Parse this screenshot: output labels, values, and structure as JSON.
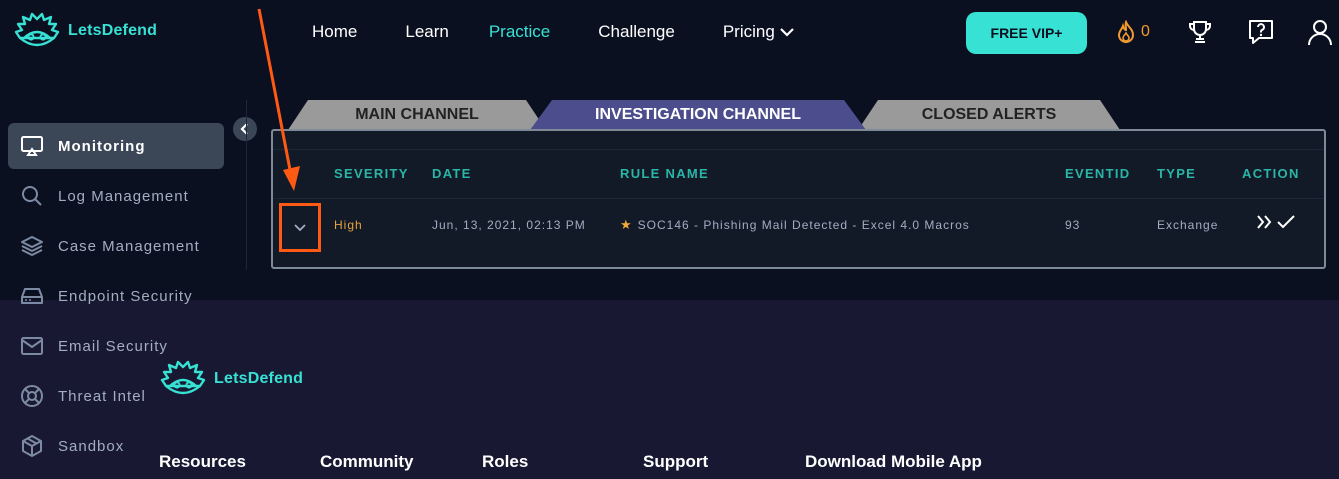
{
  "brand": {
    "name": "LetsDefend"
  },
  "nav": {
    "items": [
      "Home",
      "Learn",
      "Practice",
      "Challenge",
      "Pricing"
    ],
    "active": "Practice",
    "vip_label": "FREE VIP+",
    "streak_count": "0"
  },
  "sidebar": {
    "items": [
      {
        "label": "Monitoring",
        "icon": "monitor-icon"
      },
      {
        "label": "Log Management",
        "icon": "search-icon"
      },
      {
        "label": "Case Management",
        "icon": "layers-icon"
      },
      {
        "label": "Endpoint Security",
        "icon": "drive-icon"
      },
      {
        "label": "Email Security",
        "icon": "mail-icon"
      },
      {
        "label": "Threat Intel",
        "icon": "lifebuoy-icon"
      },
      {
        "label": "Sandbox",
        "icon": "box-icon"
      }
    ]
  },
  "tabs": [
    "MAIN CHANNEL",
    "INVESTIGATION CHANNEL",
    "CLOSED ALERTS"
  ],
  "table": {
    "headers": [
      "SEVERITY",
      "DATE",
      "RULE NAME",
      "EVENTID",
      "TYPE",
      "ACTION"
    ],
    "rows": [
      {
        "severity": "High",
        "date": "Jun, 13, 2021, 02:13 PM",
        "rule_name": "SOC146 - Phishing Mail Detected - Excel 4.0 Macros",
        "eventid": "93",
        "type": "Exchange"
      }
    ]
  },
  "footer": {
    "columns": [
      "Resources",
      "Community",
      "Roles",
      "Support",
      "Download Mobile App"
    ]
  },
  "colors": {
    "accent": "#37e1d3",
    "background": "#0b1020",
    "footer_bg": "#181832",
    "severity_high": "#e8a33c",
    "annotation": "#ff5a14"
  }
}
